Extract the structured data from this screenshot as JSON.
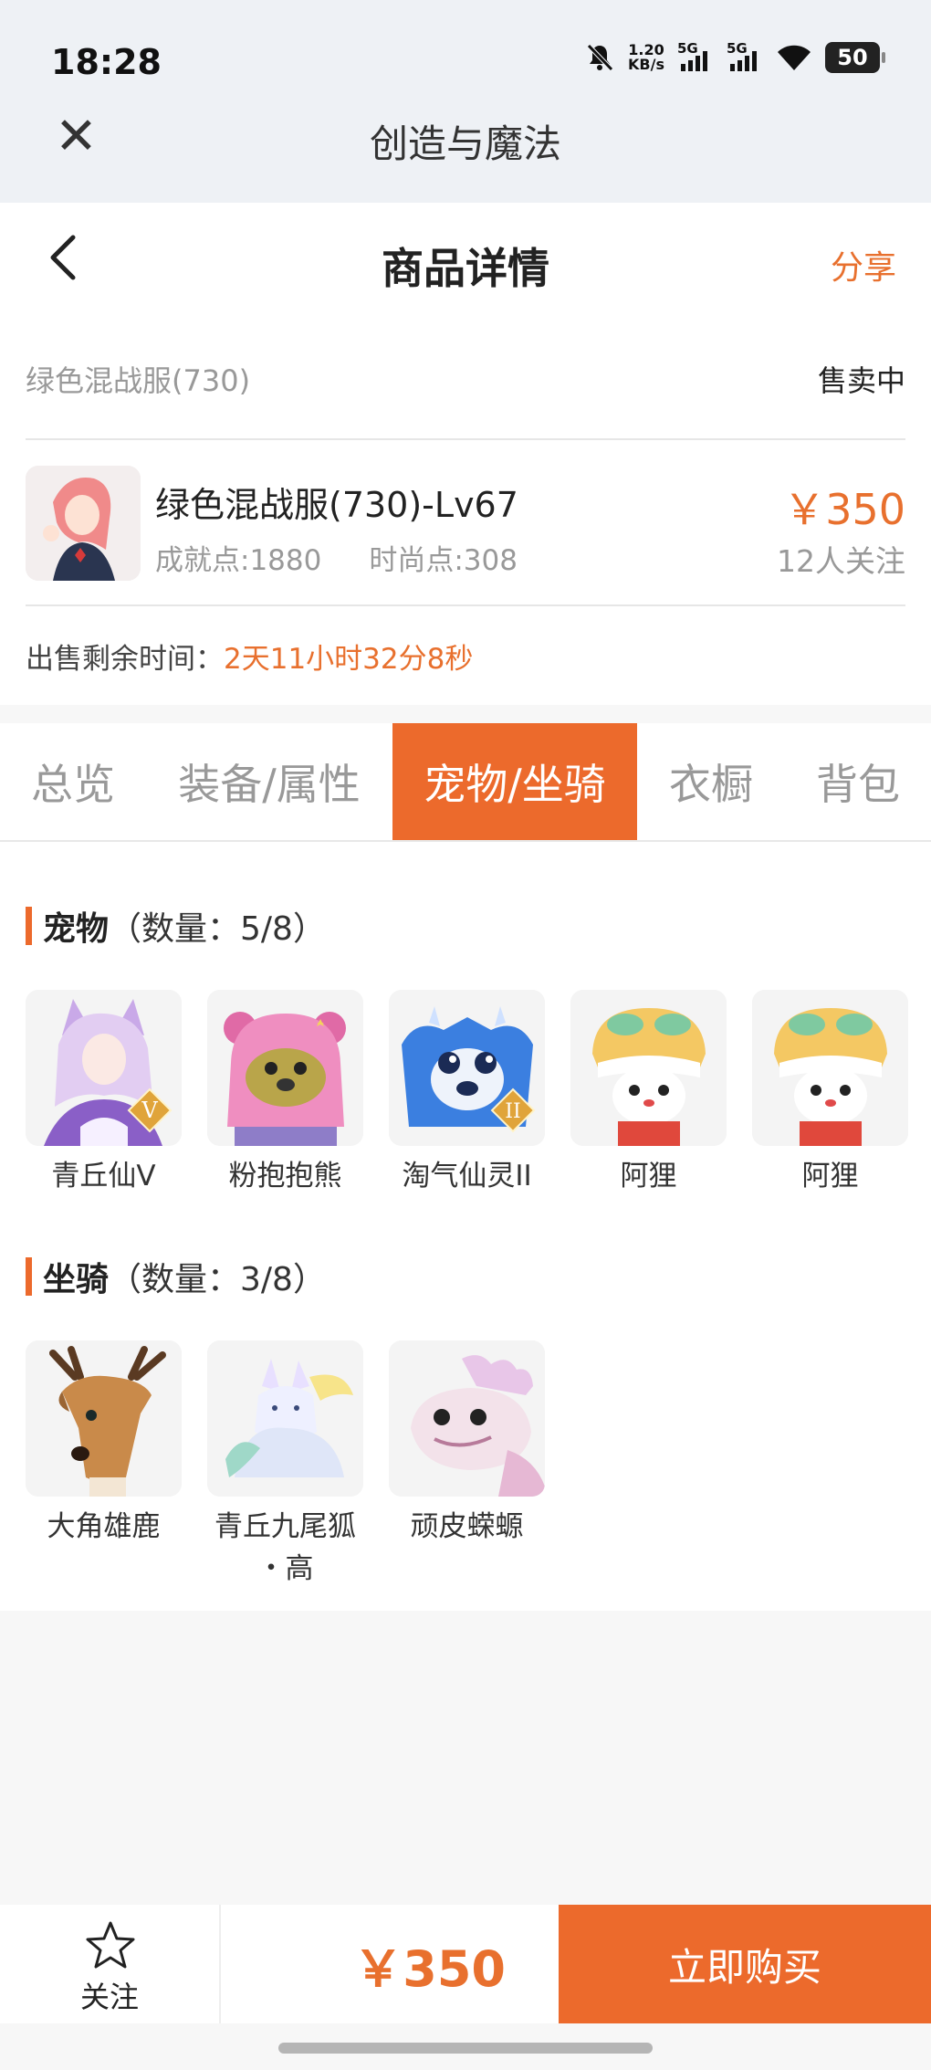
{
  "status_bar": {
    "time": "18:28",
    "net_speed_top": "1.20",
    "net_speed_bottom": "KB/s",
    "signal1": "5G",
    "signal2": "5G",
    "battery": "50"
  },
  "webview": {
    "title": "创造与魔法"
  },
  "header": {
    "title": "商品详情",
    "share_label": "分享"
  },
  "product": {
    "name": "绿色混战服(730)",
    "status": "售卖中",
    "full_title": "绿色混战服(730)-Lv67",
    "achievement": "成就点:1880",
    "fashion": "时尚点:308",
    "price": "￥350",
    "followers": "12人关注",
    "timer_label": "出售剩余时间：",
    "timer_value": "2天11小时32分8秒"
  },
  "tabs": [
    {
      "label": "总览",
      "active": false
    },
    {
      "label": "装备/属性",
      "active": false
    },
    {
      "label": "宠物/坐骑",
      "active": true
    },
    {
      "label": "衣橱",
      "active": false
    },
    {
      "label": "背包",
      "active": false
    }
  ],
  "pets": {
    "title": "宠物",
    "count": "（数量：5/8）",
    "items": [
      {
        "name": "青丘仙V",
        "icon": "fox-fairy-icon",
        "badge": "V"
      },
      {
        "name": "粉抱抱熊",
        "icon": "pink-bear-icon"
      },
      {
        "name": "淘气仙灵II",
        "icon": "blue-spirit-icon",
        "badge": "II"
      },
      {
        "name": "阿狸",
        "icon": "lion-cub-icon"
      },
      {
        "name": "阿狸",
        "icon": "lion-cub-icon"
      }
    ]
  },
  "mounts": {
    "title": "坐骑",
    "count": "（数量：3/8）",
    "items": [
      {
        "name": "大角雄鹿",
        "icon": "deer-icon"
      },
      {
        "name": "青丘九尾狐\n・高",
        "name_line1": "青丘九尾狐",
        "name_line2": "・高",
        "icon": "nine-tailed-fox-icon"
      },
      {
        "name": "顽皮蝾螈",
        "icon": "axolotl-icon"
      }
    ]
  },
  "bottom": {
    "follow_label": "关注",
    "total_price": "￥350",
    "buy_label": "立即购买"
  },
  "colors": {
    "accent": "#ec6a2c",
    "price": "#e8702e"
  }
}
